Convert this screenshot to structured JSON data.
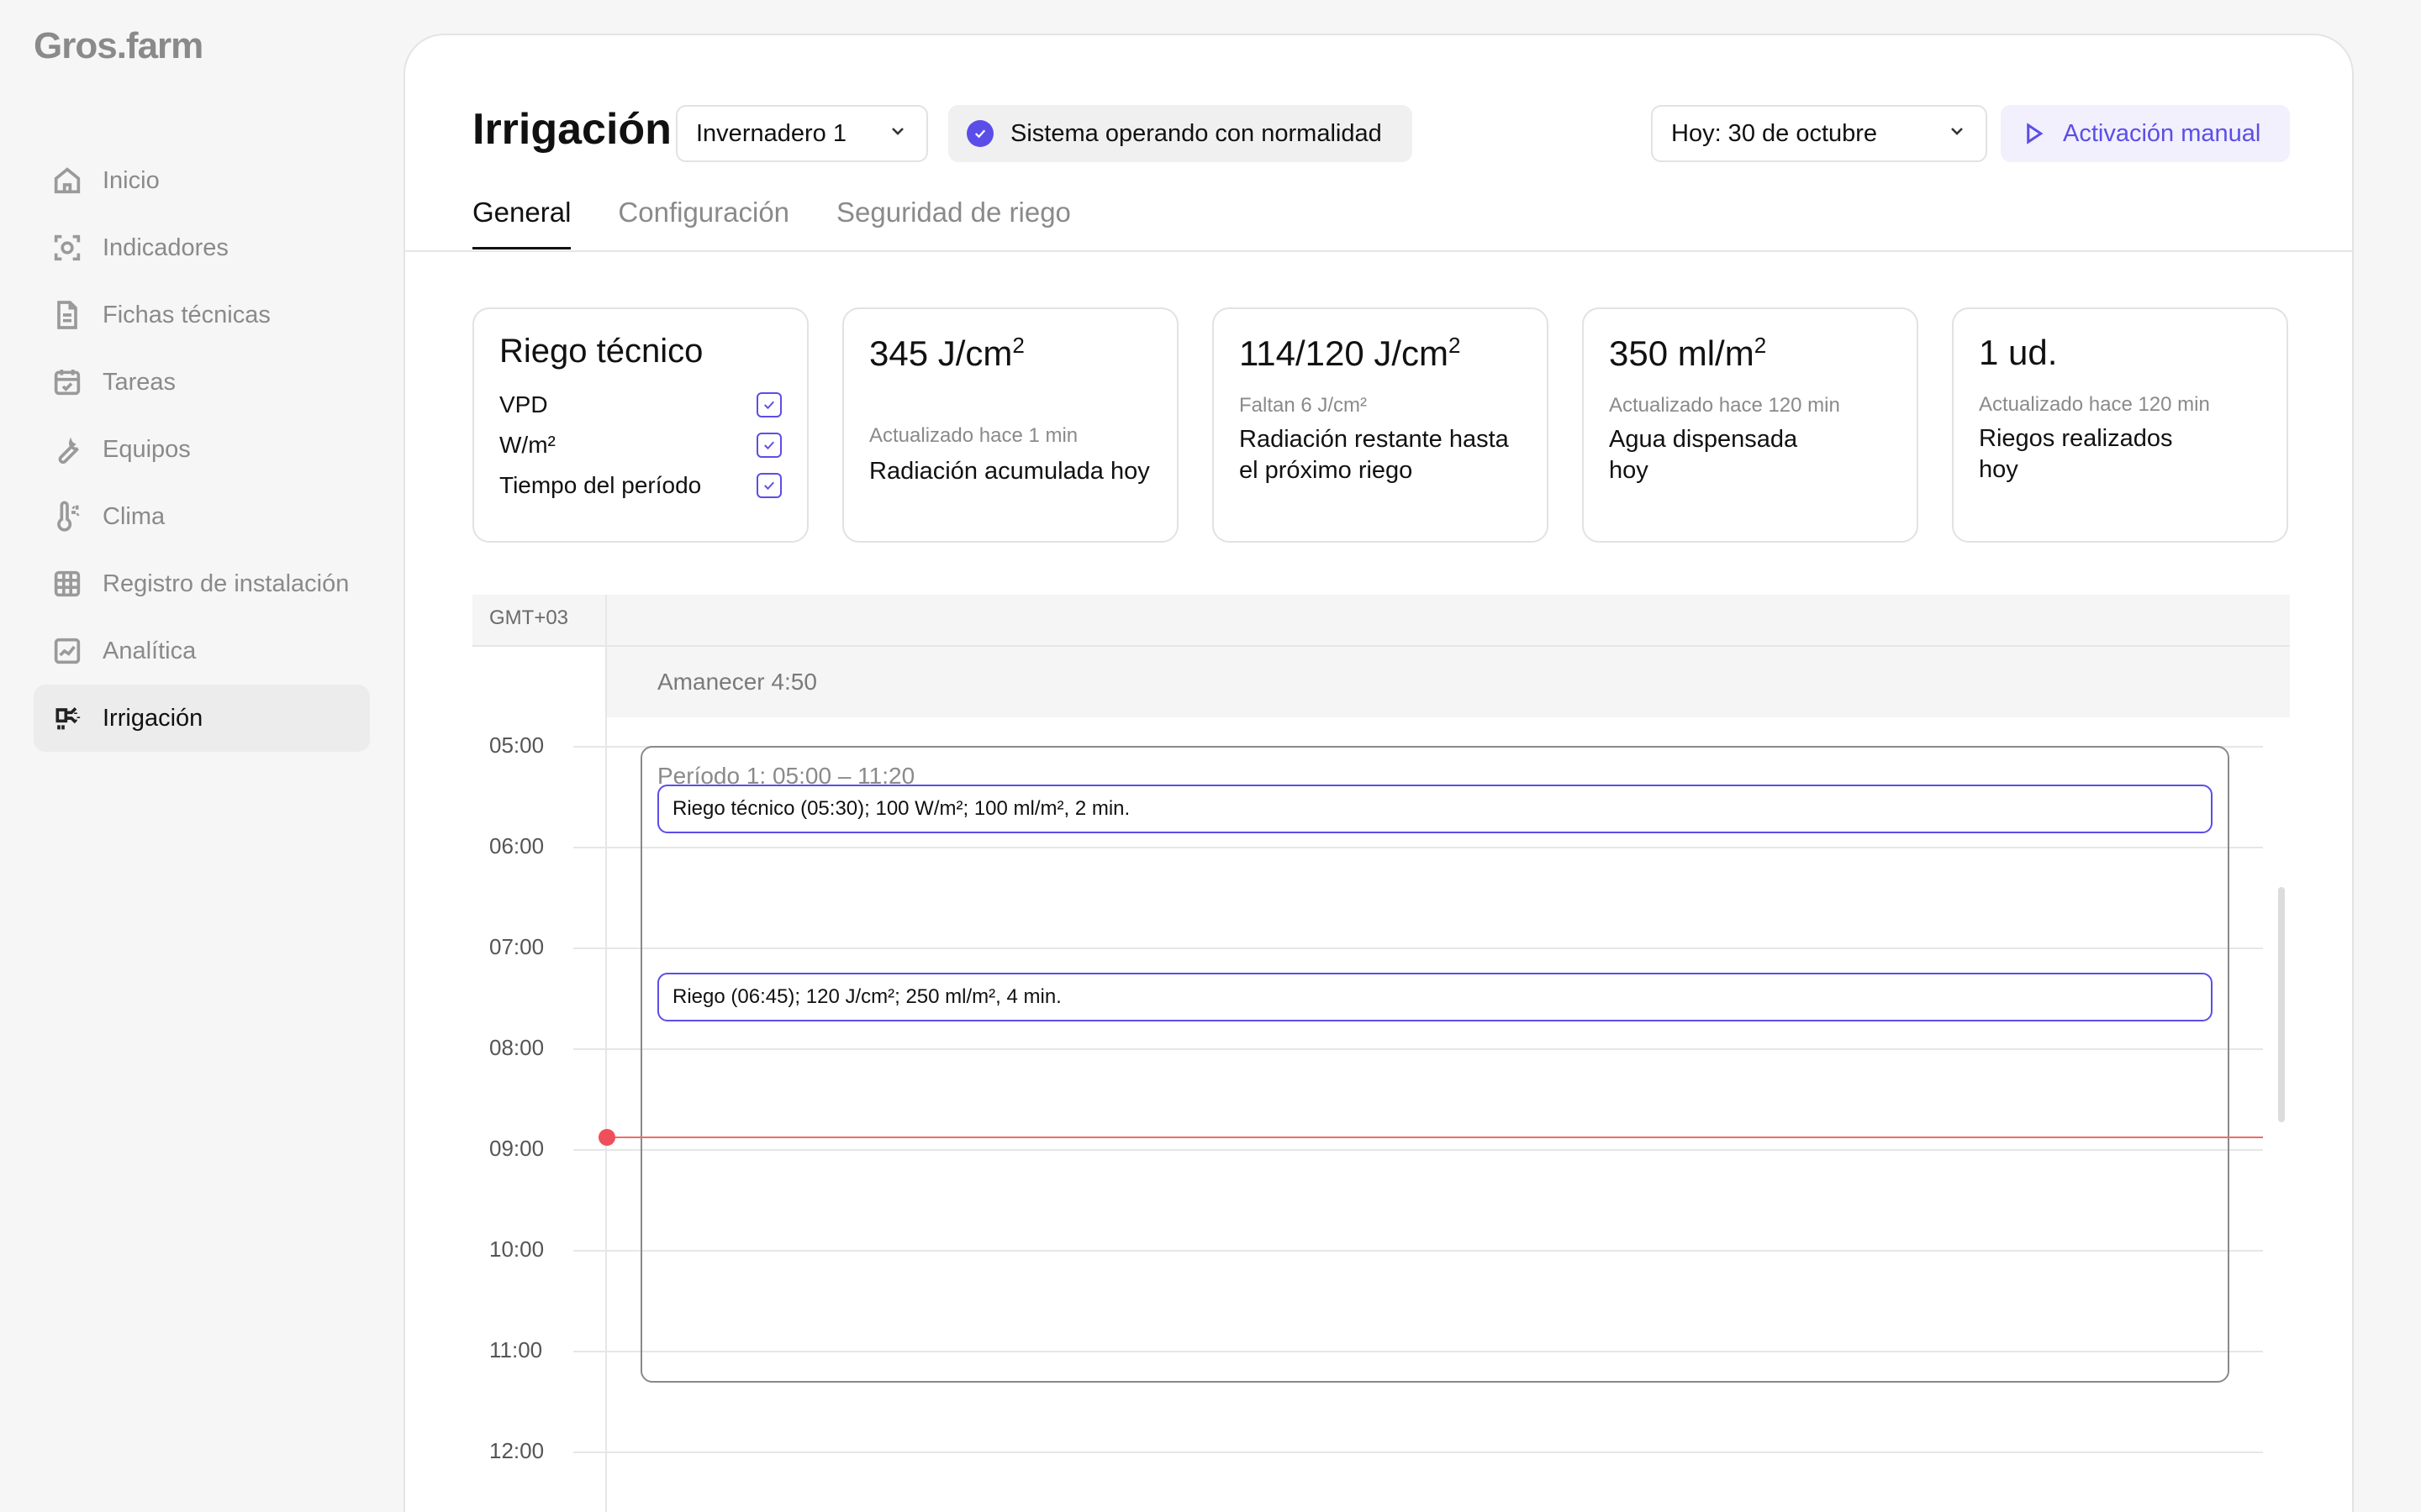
{
  "app": {
    "logo": "Gros.farm"
  },
  "sidebar": {
    "items": [
      {
        "label": "Inicio",
        "icon": "home-icon",
        "active": false
      },
      {
        "label": "Indicadores",
        "icon": "indicators-icon",
        "active": false
      },
      {
        "label": "Fichas técnicas",
        "icon": "document-icon",
        "active": false
      },
      {
        "label": "Tareas",
        "icon": "calendar-icon",
        "active": false
      },
      {
        "label": "Equipos",
        "icon": "wrench-icon",
        "active": false
      },
      {
        "label": "Clima",
        "icon": "thermometer-icon",
        "active": false
      },
      {
        "label": "Registro de instalación",
        "icon": "grid-icon",
        "active": false
      },
      {
        "label": "Analítica",
        "icon": "analytics-icon",
        "active": false
      },
      {
        "label": "Irrigación",
        "icon": "irrigation-icon",
        "active": true
      }
    ]
  },
  "header": {
    "title": "Irrigación",
    "greenhouse_select": "Invernadero 1",
    "status": "Sistema operando con normalidad",
    "date_select": "Hoy: 30 de octubre",
    "manual_button": "Activación manual"
  },
  "tabs": [
    {
      "label": "General",
      "active": true
    },
    {
      "label": "Configuración",
      "active": false
    },
    {
      "label": "Seguridad de riego",
      "active": false
    }
  ],
  "cards": {
    "technical": {
      "title": "Riego técnico",
      "options": [
        {
          "label": "VPD",
          "checked": true
        },
        {
          "label": "W/m²",
          "checked": true
        },
        {
          "label": "Tiempo del período",
          "checked": true
        }
      ]
    },
    "radiation": {
      "value": "345 J/cm",
      "value_sup": "2",
      "updated": "Actualizado hace 1 min",
      "label": "Radiación acumulada hoy"
    },
    "remaining": {
      "value": "114/120 J/cm",
      "value_sup": "2",
      "note": "Faltan 6 J/cm²",
      "label_line1": "Radiación restante hasta",
      "label_line2": "el próximo riego"
    },
    "water": {
      "value": "350 ml/m",
      "value_sup": "2",
      "updated": "Actualizado hace 120 min",
      "label_line1": "Agua dispensada",
      "label_line2": "hoy"
    },
    "irrigations": {
      "value": "1 ud.",
      "updated": "Actualizado hace 120 min",
      "label_line1": "Riegos realizados",
      "label_line2": "hoy"
    }
  },
  "timeline": {
    "timezone": "GMT+03",
    "sunrise": "Amanecer 4:50",
    "hours": [
      "05:00",
      "06:00",
      "07:00",
      "08:00",
      "09:00",
      "10:00",
      "11:00",
      "12:00"
    ],
    "period_label": "Período 1: 05:00 – 11:20",
    "events": [
      {
        "label": "Riego técnico (05:30); 100 W/m²; 100 ml/m², 2 min."
      },
      {
        "label": "Riego (06:45); 120 J/cm²; 250 ml/m², 4 min."
      }
    ],
    "now_indicator": {
      "color": "#ef4f5a"
    }
  },
  "colors": {
    "accent": "#5b4ee8",
    "now": "#ef4f5a",
    "muted": "#8a8a8a"
  }
}
